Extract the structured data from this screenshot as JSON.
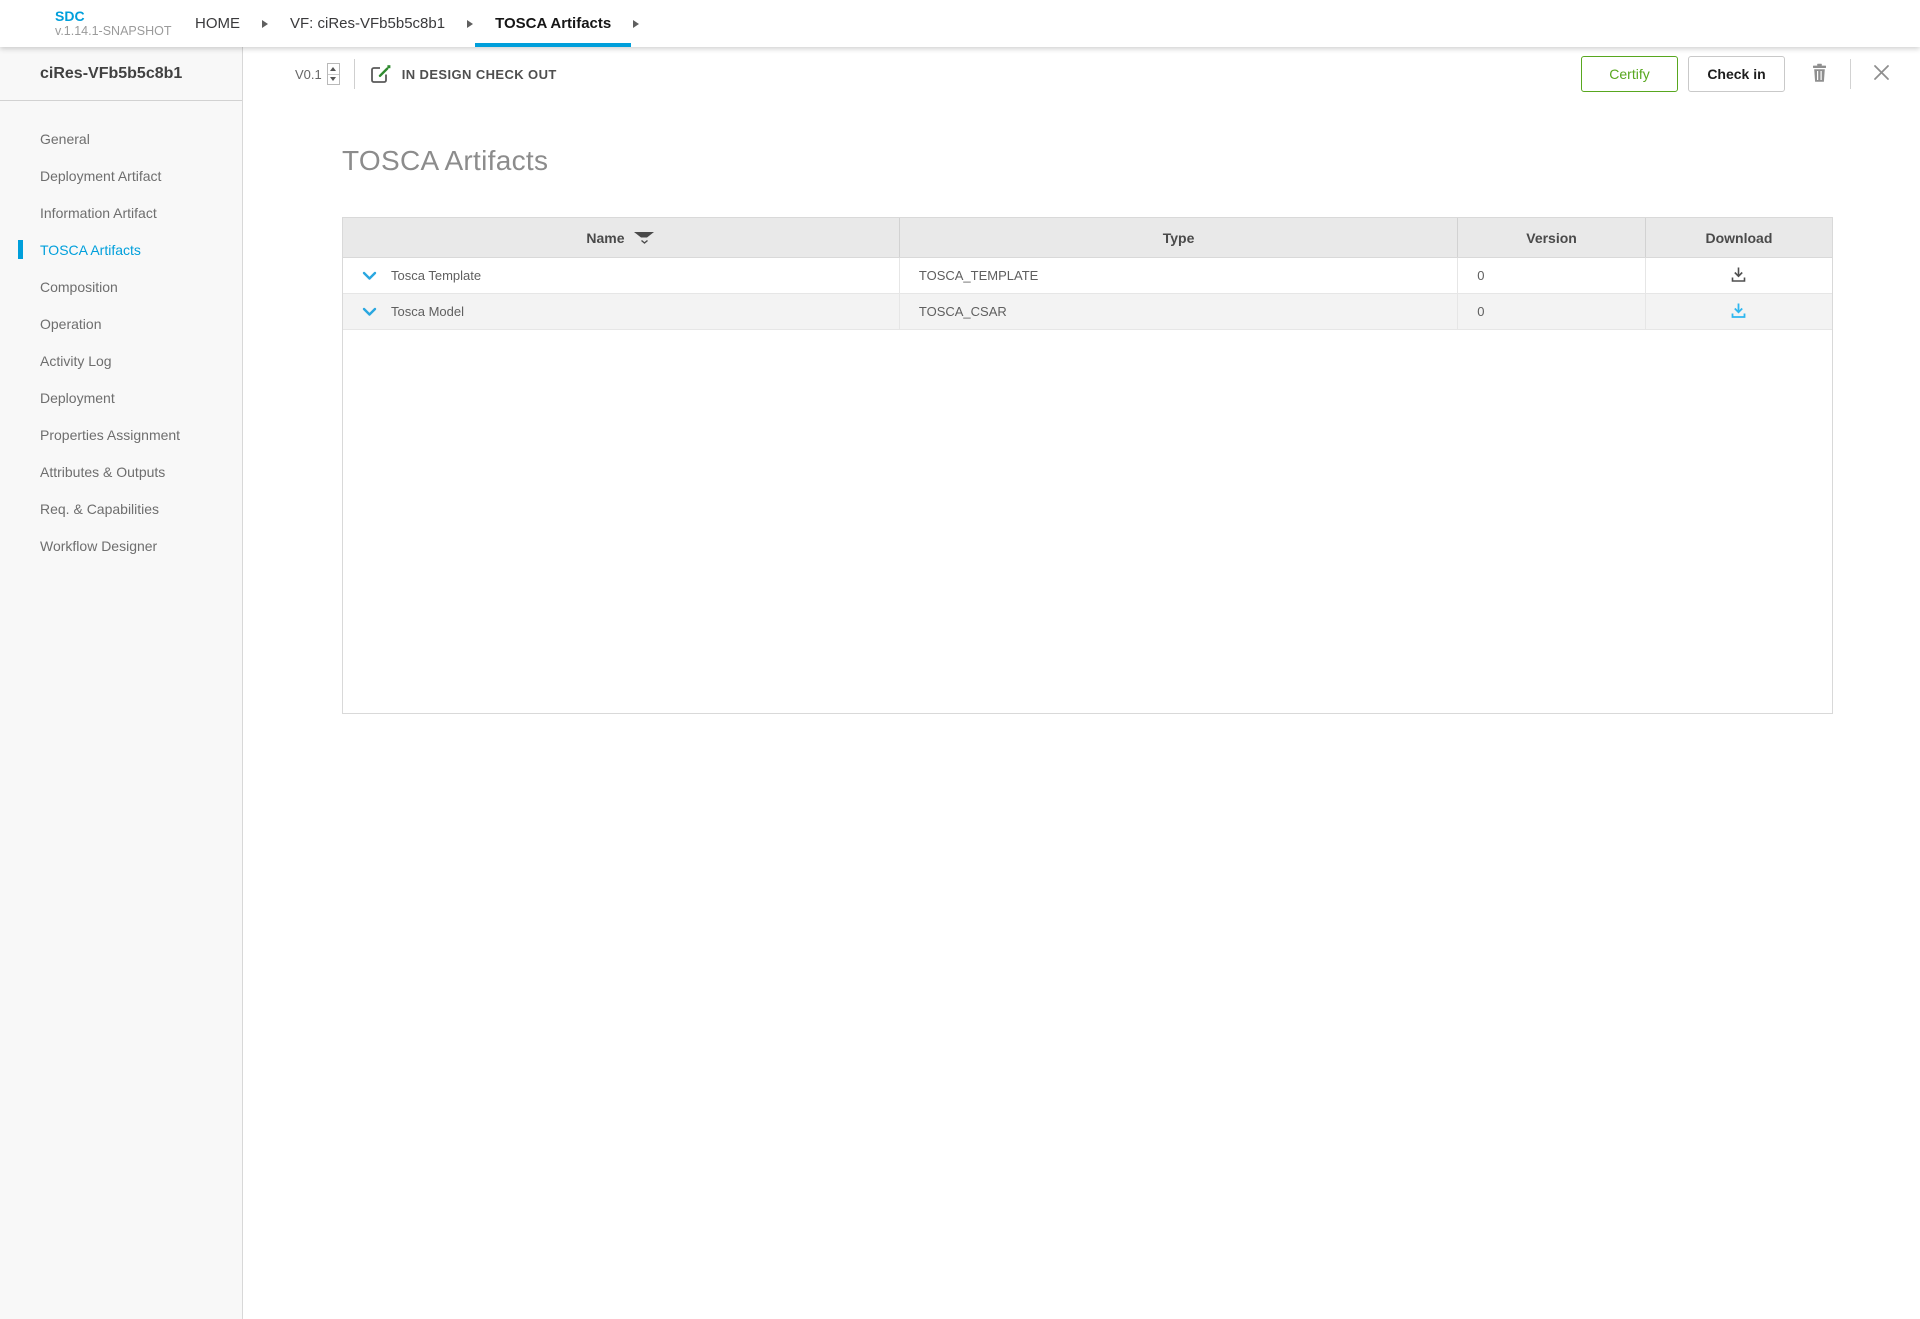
{
  "topbar": {
    "logo": {
      "title": "SDC",
      "version": "v.1.14.1-SNAPSHOT"
    },
    "breadcrumbs": [
      {
        "label": "HOME"
      },
      {
        "label": "VF: ciRes-VFb5b5c8b1"
      },
      {
        "label": "TOSCA Artifacts"
      }
    ]
  },
  "toolbar": {
    "version": "V0.1",
    "status": "IN DESIGN CHECK OUT",
    "certify_label": "Certify",
    "checkin_label": "Check in"
  },
  "sidebar": {
    "title": "ciRes-VFb5b5c8b1",
    "active_item": "TOSCA Artifacts",
    "items": [
      {
        "label": "General"
      },
      {
        "label": "Deployment Artifact"
      },
      {
        "label": "Information Artifact"
      },
      {
        "label": "TOSCA Artifacts"
      },
      {
        "label": "Composition"
      },
      {
        "label": "Operation"
      },
      {
        "label": "Activity Log"
      },
      {
        "label": "Deployment"
      },
      {
        "label": "Properties Assignment"
      },
      {
        "label": "Attributes & Outputs"
      },
      {
        "label": "Req. & Capabilities"
      },
      {
        "label": "Workflow Designer"
      }
    ]
  },
  "main": {
    "heading": "TOSCA Artifacts",
    "table": {
      "columns": [
        {
          "label": "Name"
        },
        {
          "label": "Type"
        },
        {
          "label": "Version"
        },
        {
          "label": "Download"
        }
      ],
      "rows": [
        {
          "name": "Tosca Template",
          "type": "TOSCA_TEMPLATE",
          "version": "0"
        },
        {
          "name": "Tosca Model",
          "type": "TOSCA_CSAR",
          "version": "0"
        }
      ]
    }
  },
  "colors": {
    "accent_blue": "#009fdb",
    "certify_green": "#58a71f",
    "pencil_green": "#2f8a2f",
    "download_highlight": "#2eb7f0",
    "header_gray": "#e9e9e9",
    "row_alt_gray": "#f3f3f3"
  }
}
